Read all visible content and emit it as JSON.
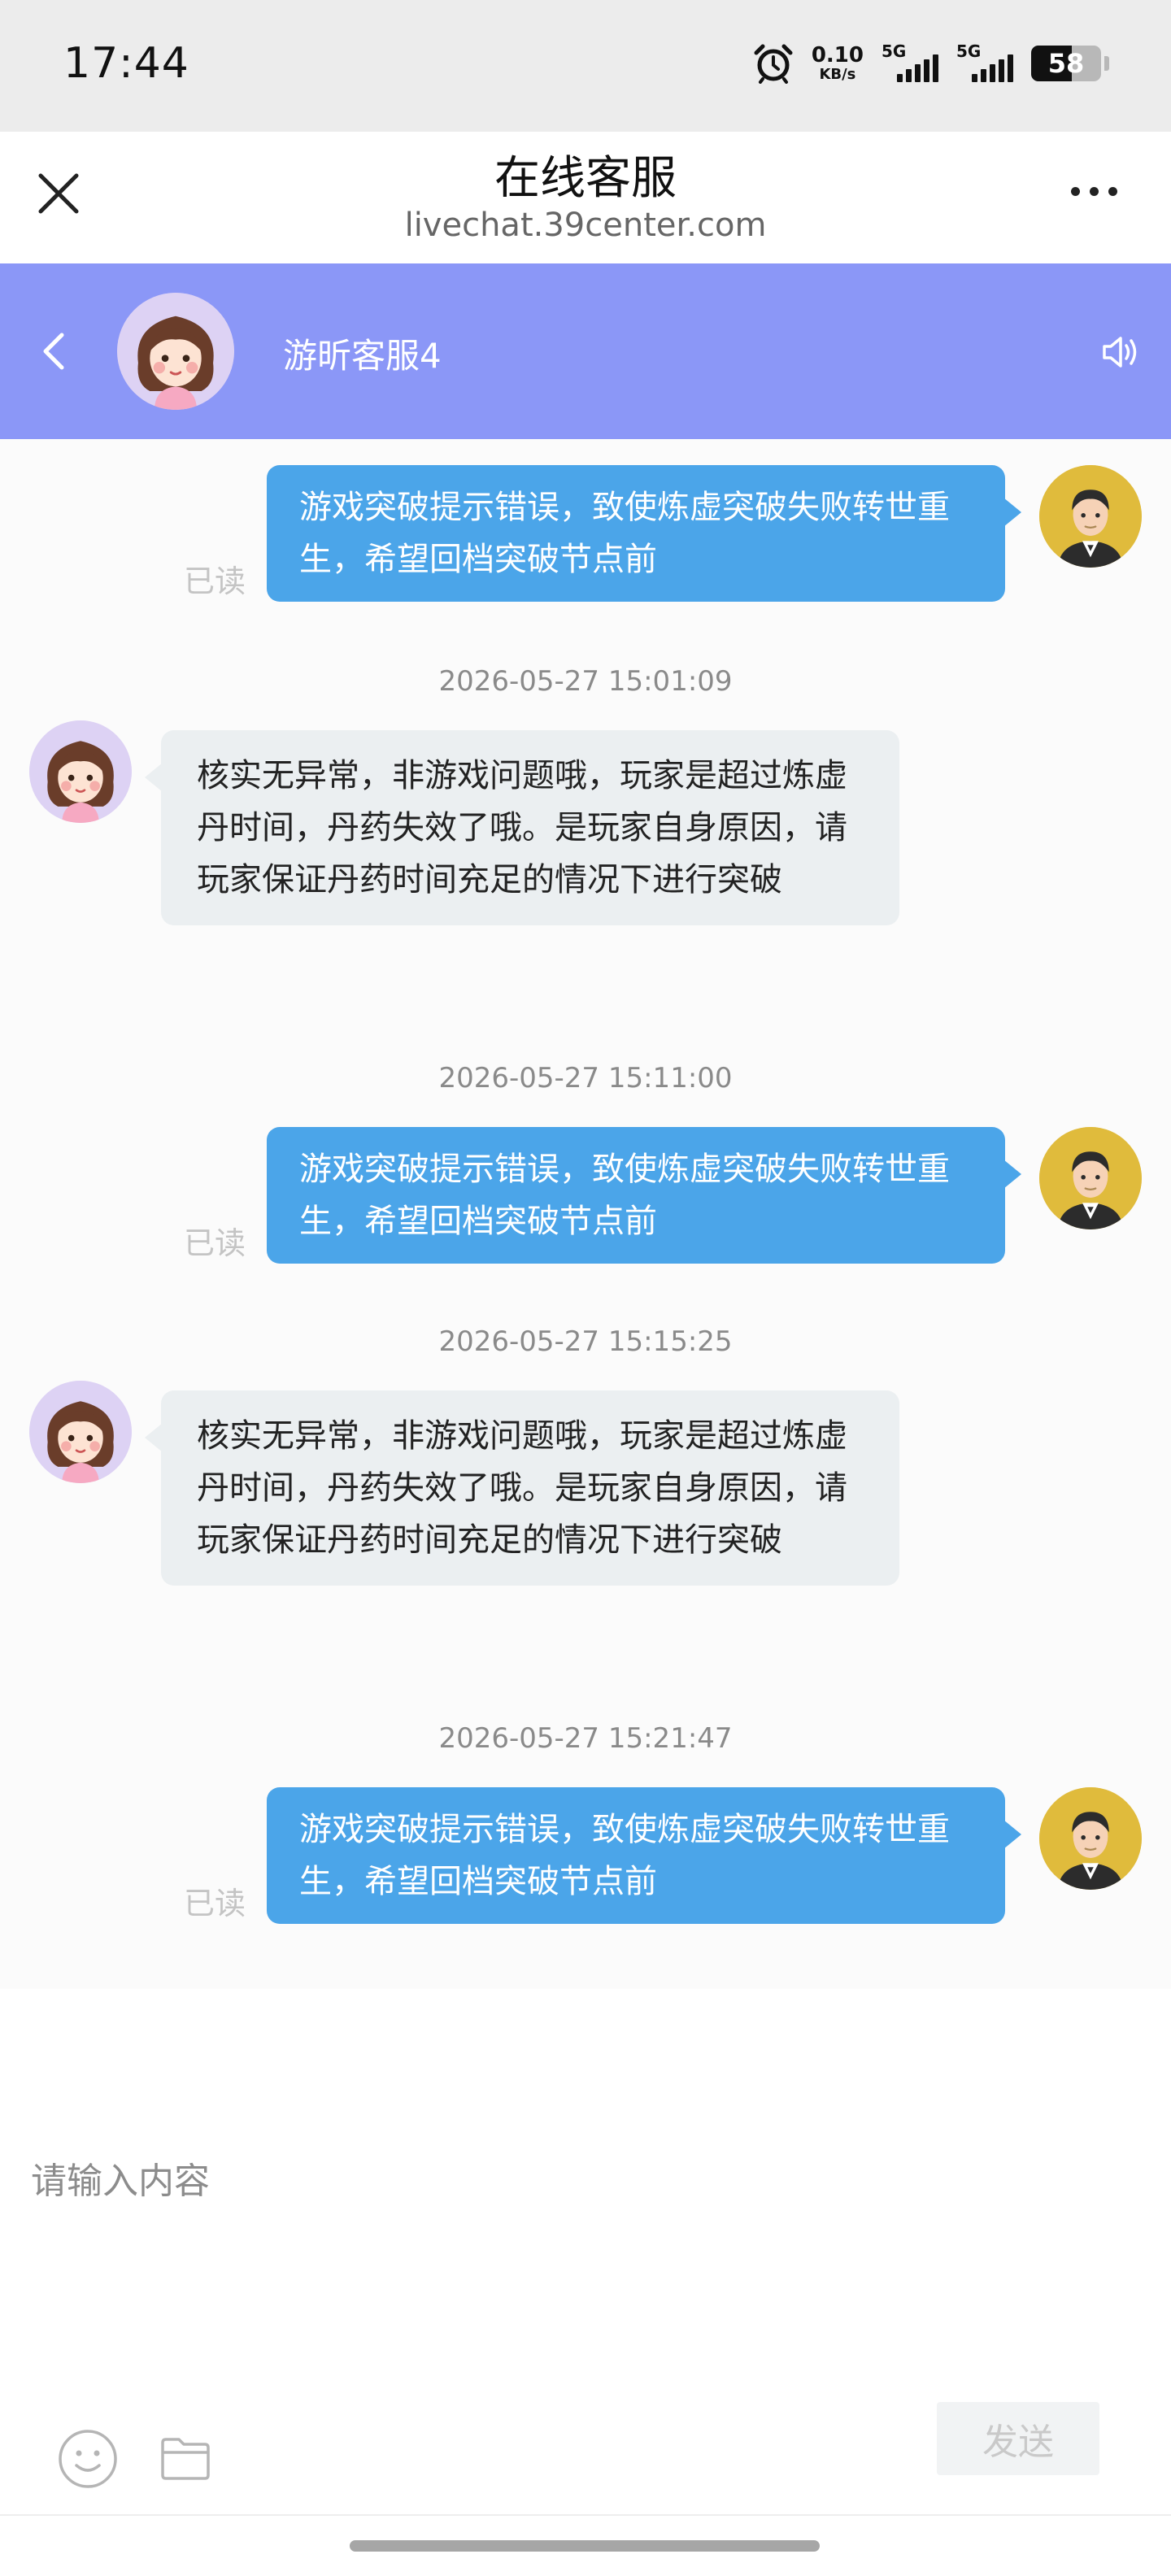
{
  "status_bar": {
    "time": "17:44",
    "net_speed_value": "0.10",
    "net_speed_unit": "KB/s",
    "sim1_label": "5G",
    "sim2_label": "5G",
    "battery_level": "58",
    "icons": [
      "alarm-icon",
      "signal-icon",
      "battery-icon"
    ]
  },
  "webview": {
    "title": "在线客服",
    "url": "livechat.39center.com",
    "icons": [
      "close-icon",
      "more-icon"
    ]
  },
  "chat_header": {
    "agent_name": "游昕客服4",
    "icons": [
      "back-icon",
      "speaker-icon"
    ],
    "accent_color": "#8b97f7"
  },
  "messages": [
    {
      "type": "outgoing",
      "text": "游戏突破提示错误，致使炼虚突破失败转世重生，希望回档突破节点前",
      "status": "已读"
    },
    {
      "type": "timestamp",
      "text": "2026-05-27 15:01:09"
    },
    {
      "type": "incoming",
      "text": "核实无异常，非游戏问题哦，玩家是超过炼虚丹时间，丹药失效了哦。是玩家自身原因，请玩家保证丹药时间充足的情况下进行突破"
    },
    {
      "type": "timestamp",
      "text": "2026-05-27 15:11:00"
    },
    {
      "type": "outgoing",
      "text": "游戏突破提示错误，致使炼虚突破失败转世重生，希望回档突破节点前",
      "status": "已读"
    },
    {
      "type": "timestamp",
      "text": "2026-05-27 15:15:25"
    },
    {
      "type": "incoming",
      "text": "核实无异常，非游戏问题哦，玩家是超过炼虚丹时间，丹药失效了哦。是玩家自身原因，请玩家保证丹药时间充足的情况下进行突破"
    },
    {
      "type": "timestamp",
      "text": "2026-05-27 15:21:47"
    },
    {
      "type": "outgoing",
      "text": "游戏突破提示错误，致使炼虚突破失败转世重生，希望回档突破节点前",
      "status": "已读"
    }
  ],
  "composer": {
    "placeholder": "请输入内容",
    "value": "",
    "send_label": "发送",
    "icons": [
      "emoji-icon",
      "folder-icon"
    ]
  },
  "colors": {
    "outgoing_bubble": "#4ba5e9",
    "incoming_bubble": "#ebeff1",
    "header": "#8b97f7"
  }
}
